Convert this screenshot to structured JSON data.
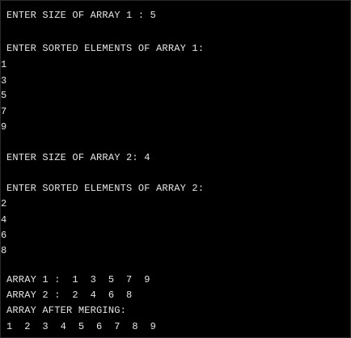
{
  "console": {
    "lines": [
      "ENTER SIZE OF ARRAY 1 : 5",
      "ENTER SORTED ELEMENTS OF ARRAY 1:",
      "1",
      "3",
      "5",
      "7",
      "9",
      "ENTER SIZE OF ARRAY 2: 4",
      "ENTER SORTED ELEMENTS OF ARRAY 2:",
      "2",
      "4",
      "6",
      "8",
      "ARRAY 1 :  1  3  5  7  9",
      "ARRAY 2 :  2  4  6  8",
      "ARRAY AFTER MERGING:",
      "1  2  3  4  5  6  7  8  9"
    ]
  }
}
